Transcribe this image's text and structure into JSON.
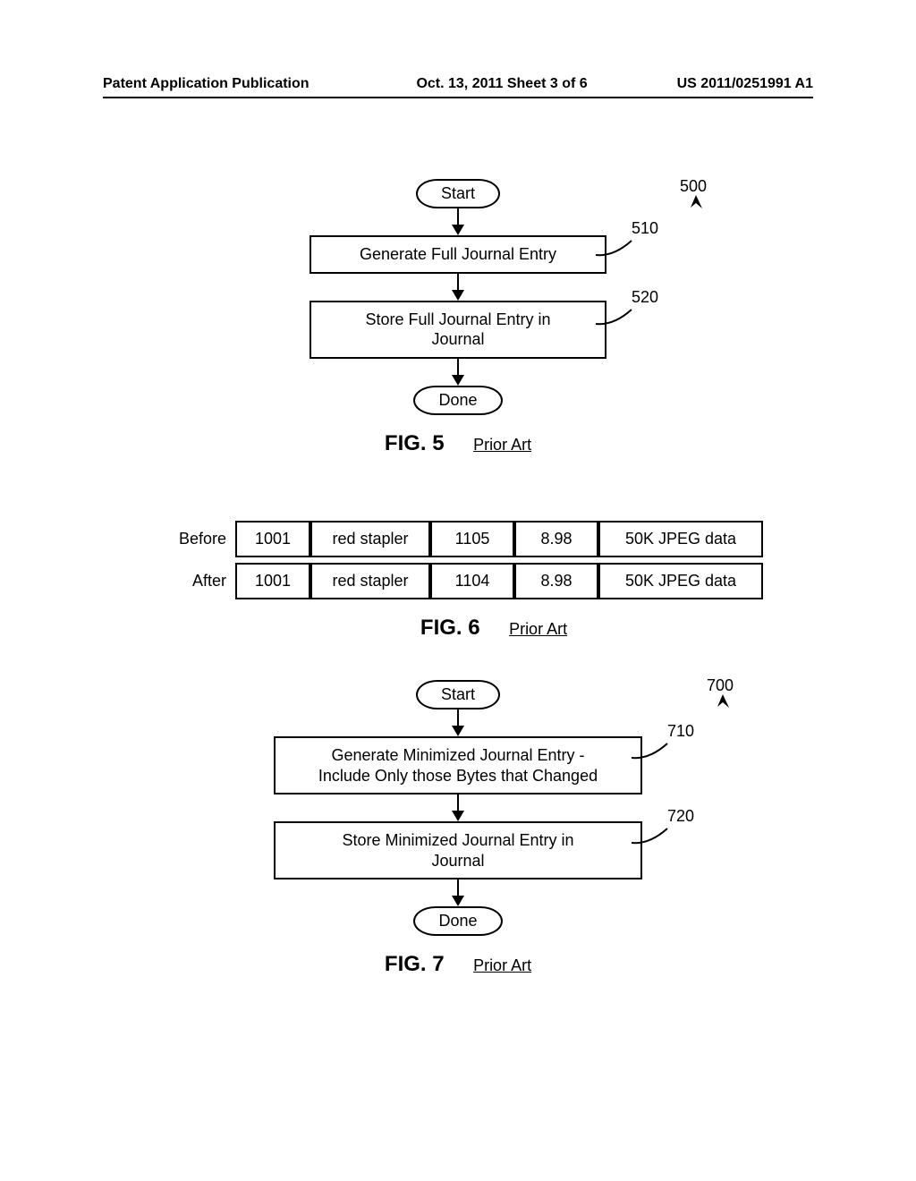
{
  "header": {
    "left": "Patent Application Publication",
    "center": "Oct. 13, 2011  Sheet 3 of 6",
    "right": "US 2011/0251991 A1"
  },
  "fig5": {
    "ref_main": "500",
    "start": "Start",
    "step1": {
      "text": "Generate Full Journal Entry",
      "ref": "510"
    },
    "step2": {
      "text_l1": "Store Full Journal Entry in",
      "text_l2": "Journal",
      "ref": "520"
    },
    "done": "Done",
    "caption": "FIG. 5",
    "prior": "Prior Art"
  },
  "fig6": {
    "rows": [
      {
        "label": "Before",
        "c1": "1001",
        "c2": "red stapler",
        "c3": "1105",
        "c4": "8.98",
        "c5": "50K JPEG data"
      },
      {
        "label": "After",
        "c1": "1001",
        "c2": "red stapler",
        "c3": "1104",
        "c4": "8.98",
        "c5": "50K JPEG data"
      }
    ],
    "caption": "FIG. 6",
    "prior": "Prior Art"
  },
  "fig7": {
    "ref_main": "700",
    "start": "Start",
    "step1": {
      "text_l1": "Generate Minimized Journal Entry -",
      "text_l2": "Include Only those Bytes that Changed",
      "ref": "710"
    },
    "step2": {
      "text_l1": "Store Minimized Journal Entry in",
      "text_l2": "Journal",
      "ref": "720"
    },
    "done": "Done",
    "caption": "FIG. 7",
    "prior": "Prior Art"
  }
}
